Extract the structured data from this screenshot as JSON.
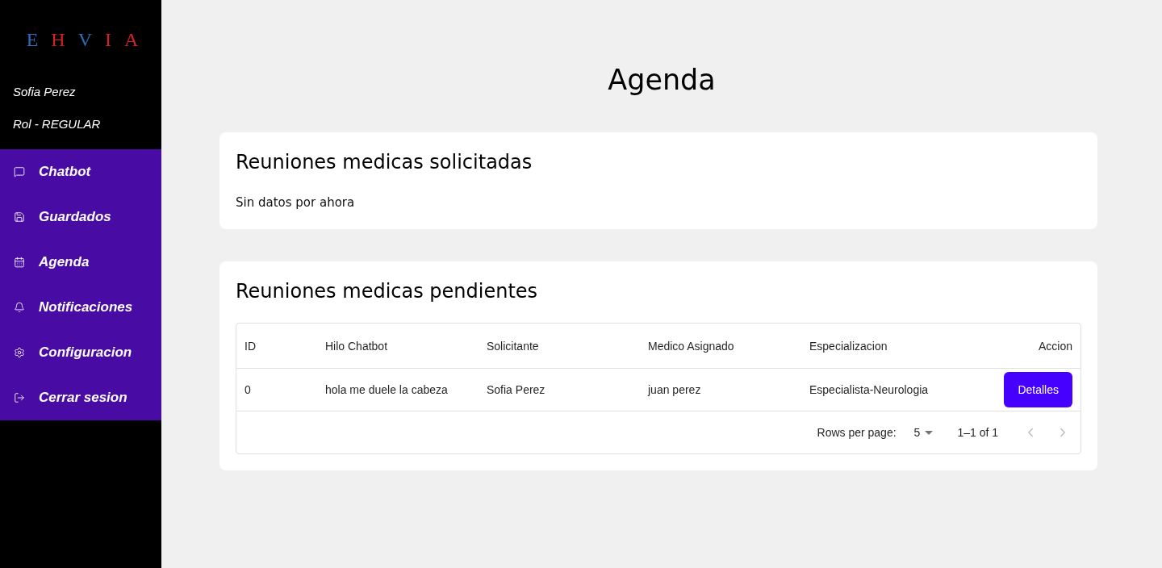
{
  "sidebar": {
    "logo": [
      {
        "letter": "E",
        "color": "#2e6db4"
      },
      {
        "letter": "H",
        "color": "#d3202a"
      },
      {
        "letter": "V",
        "color": "#2e6db4"
      },
      {
        "letter": "I",
        "color": "#d3202a"
      },
      {
        "letter": "A",
        "color": "#d3202a"
      }
    ],
    "user_name": "Sofia Perez",
    "role": "Rol - REGULAR",
    "nav": [
      {
        "kind": "chat",
        "label": "Chatbot"
      },
      {
        "kind": "save",
        "label": "Guardados"
      },
      {
        "kind": "calendar",
        "label": "Agenda"
      },
      {
        "kind": "bell",
        "label": "Notificaciones"
      },
      {
        "kind": "settings",
        "label": "Configuracion"
      },
      {
        "kind": "logout",
        "label": "Cerrar sesion"
      }
    ]
  },
  "page_title": "Agenda",
  "requested": {
    "title": "Reuniones medicas solicitadas",
    "message": "Sin datos por ahora"
  },
  "pending": {
    "title": "Reuniones medicas pendientes",
    "table": {
      "columns": [
        "ID",
        "Hilo Chatbot",
        "Solicitante",
        "Medico Asignado",
        "Especializacion",
        "Accion"
      ],
      "rows": [
        {
          "cells": [
            "0",
            "hola me duele la cabeza",
            "Sofia Perez",
            "juan perez",
            "Especialista-Neurologia"
          ],
          "action": "Detalles"
        }
      ],
      "pagination": {
        "rows_label": "Rows per page:",
        "rows_value": "5",
        "range": "1–1 of 1",
        "prev": {
          "disabled": true
        },
        "next": {
          "disabled": true
        }
      }
    }
  }
}
